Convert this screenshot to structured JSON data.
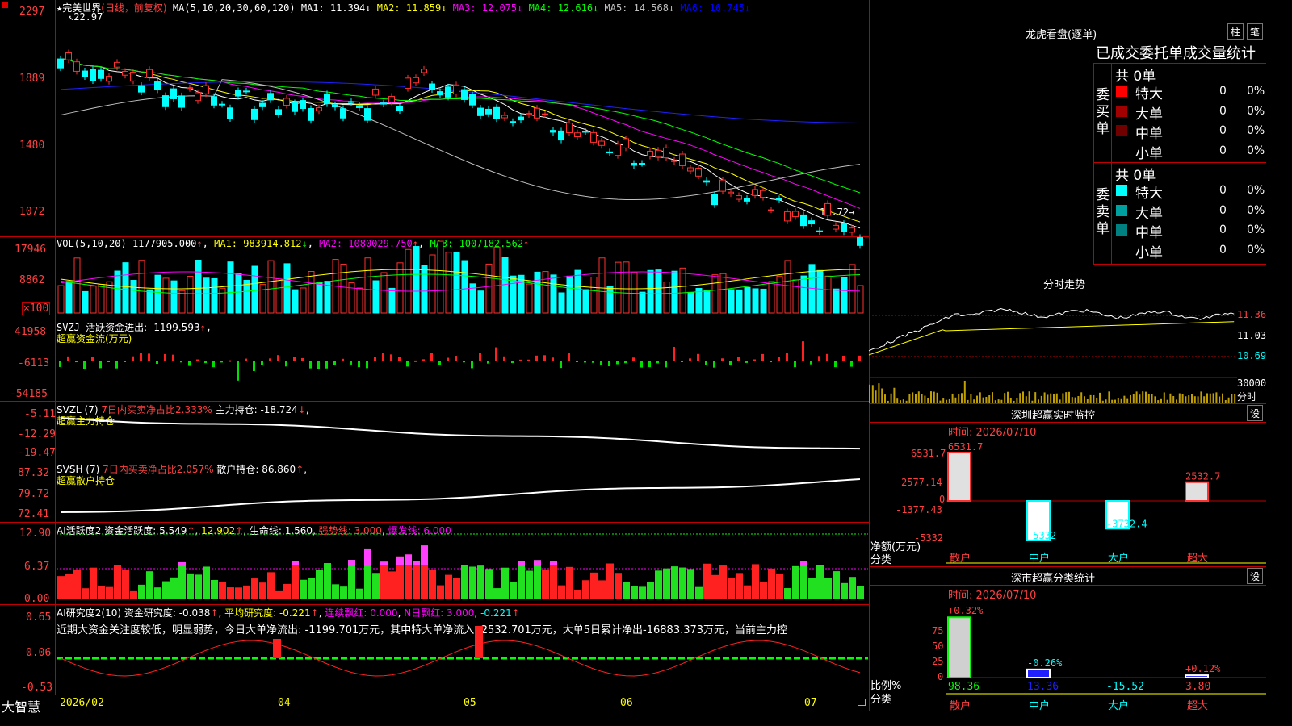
{
  "stock": {
    "name": "完美世界",
    "mode": "(日线，前复权)",
    "high_mark": "22.97",
    "low_mark": "10.72→"
  },
  "price_header": {
    "ma_label": "MA(5,10,20,30,60,120)",
    "items": [
      {
        "label": "MA1: 11.394",
        "arrow": "↓",
        "color": "#ffffff"
      },
      {
        "label": "MA2: 11.859",
        "arrow": "↓",
        "color": "#ffff00"
      },
      {
        "label": "MA3: 12.075",
        "arrow": "↓",
        "color": "#ff00ff"
      },
      {
        "label": "MA4: 12.616",
        "arrow": "↓",
        "color": "#00ff00"
      },
      {
        "label": "MA5: 14.568",
        "arrow": "↓",
        "color": "#c0c0c0"
      },
      {
        "label": "MA6: 16.745",
        "arrow": "↓",
        "color": "#0000ff"
      }
    ],
    "y_labels": [
      "2297",
      "1889",
      "1480",
      "1072"
    ]
  },
  "vol_panel": {
    "label": "VOL(5,10,20)",
    "value": "1177905.000",
    "ma1": "MA1: 983914.812",
    "ma2": "MA2: 1080029.750",
    "ma3": "MA3: 1007182.562",
    "y_labels": [
      "17946",
      "8862",
      "×100"
    ]
  },
  "svzj_panel": {
    "label": "SVZJ",
    "item": "活跃资金进出: -1199.593",
    "sub": "超赢资金流(万元)",
    "y_labels": [
      "41958",
      "-6113",
      "-54185"
    ]
  },
  "svzl_panel": {
    "label": "SVZL (7)",
    "item1": "7日内买卖净占比2.333%",
    "item2": "主力持仓: -18.724",
    "sub": "超赢主力持仓",
    "y_labels": [
      "-5.11",
      "-12.29",
      "-19.47"
    ]
  },
  "svsh_panel": {
    "label": "SVSH (7)",
    "item1": "7日内买卖净占比2.057%",
    "item2": "散户持仓: 86.860",
    "sub": "超赢散户持仓",
    "y_labels": [
      "87.32",
      "79.72",
      "72.41"
    ]
  },
  "ai_active": {
    "label": "AI活跃度2",
    "item1": "资金活跃度: 5.549",
    "item2": "12.902",
    "item3": "生命线: 1.560",
    "item4": "强势线: 3.000",
    "item5": "爆发线: 6.000",
    "y_labels": [
      "12.90",
      "6.37",
      "0.00"
    ]
  },
  "ai_research": {
    "label": "AI研究度2(10)",
    "item1": "资金研究度: -0.038",
    "item2": "平均研究度: -0.221",
    "item3": "连续飘红: 0.000",
    "item4": "N日飘红: 3.000",
    "item5": "-0.221",
    "comment": "近期大资金关注度较低，明显弱势，今日大单净流出: -1199.701万元，其中特大单净流入: 2532.701万元，大单5日累计净出-16883.373万元，当前主力控",
    "y_labels": [
      "0.65",
      "0.06",
      "-0.53"
    ]
  },
  "x_axis": {
    "brand": "大智慧",
    "dates": [
      "2026/02",
      "04",
      "05",
      "06",
      "07"
    ]
  },
  "dragon": {
    "title": "龙虎看盘(逐单)",
    "btn1": "柱",
    "btn2": "笔",
    "tabs": "已成交委托单成交量统计",
    "buy_label": "委买单",
    "sell_label": "委卖单",
    "buy_total": "共 0单",
    "sell_total": "共 0单",
    "buy_rows": [
      {
        "name": "特大",
        "n": "0",
        "p": "0%",
        "color": "#ff0000"
      },
      {
        "name": "大单",
        "n": "0",
        "p": "0%",
        "color": "#a00000"
      },
      {
        "name": "中单",
        "n": "0",
        "p": "0%",
        "color": "#700000"
      },
      {
        "name": "小单",
        "n": "0",
        "p": "0%",
        "color": "#000000"
      }
    ],
    "sell_rows": [
      {
        "name": "特大",
        "n": "0",
        "p": "0%",
        "color": "#00ffff"
      },
      {
        "name": "大单",
        "n": "0",
        "p": "0%",
        "color": "#00a0a0"
      },
      {
        "name": "中单",
        "n": "0",
        "p": "0%",
        "color": "#008080"
      },
      {
        "name": "小单",
        "n": "0",
        "p": "0%",
        "color": "#000000"
      }
    ]
  },
  "intraday": {
    "title": "分时走势",
    "p1": "11.36",
    "p2": "11.03",
    "p3": "10.69",
    "v1": "30000",
    "v2": "分时"
  },
  "sz_monitor": {
    "title": "深圳超赢实时监控",
    "btn": "设",
    "time": "时间: 2026/07/10",
    "y_labels": [
      "6531.7",
      "2577.14",
      "0",
      "-1377.43",
      "-5332"
    ],
    "unit": "净额(万元)",
    "class_label": "分类",
    "bars": [
      {
        "cat": "散户",
        "v": "6531.7"
      },
      {
        "cat": "中户",
        "v": "-5332"
      },
      {
        "cat": "大户",
        "v": "-3732.4"
      },
      {
        "cat": "超大",
        "v": "2532.7"
      }
    ]
  },
  "sz_class": {
    "title": "深市超赢分类统计",
    "btn": "设",
    "time": "时间: 2026/07/10",
    "y_labels": [
      "75",
      "50",
      "25",
      "0"
    ],
    "unit": "比例%",
    "class_label": "分类",
    "bars": [
      {
        "cat": "散户",
        "top": "+0.32%",
        "v": "98.36"
      },
      {
        "cat": "中户",
        "top": "-0.26%",
        "v": "13.36"
      },
      {
        "cat": "大户",
        "top": "",
        "v": "-15.52"
      },
      {
        "cat": "超大",
        "top": "+0.12%",
        "v": "3.80"
      }
    ]
  }
}
